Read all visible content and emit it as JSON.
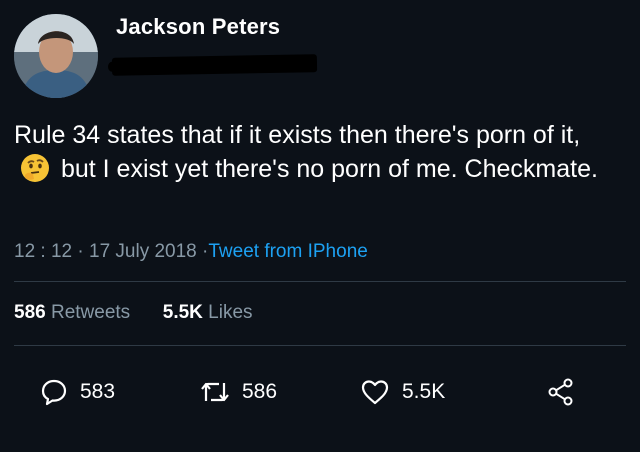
{
  "author": {
    "name": "Jackson Peters"
  },
  "tweet": {
    "text_part1": "Rule 34 states that if it exists then there's porn of it,",
    "emoji": "thinking-face-emoji",
    "text_part2": "but I exist yet there's no porn of me. Checkmate.",
    "time": "12 : 12",
    "date": "17 July 2018",
    "source": "Tweet from IPhone"
  },
  "stats": {
    "retweets_count": "586",
    "retweets_label": "Retweets",
    "likes_count": "5.5K",
    "likes_label": "Likes"
  },
  "actions": {
    "reply_count": "583",
    "retweet_count": "586",
    "like_count": "5.5K",
    "reply_icon": "comment-icon",
    "retweet_icon": "retweet-icon",
    "like_icon": "heart-icon",
    "share_icon": "share-icon"
  },
  "colors": {
    "background": "#0c1118",
    "muted": "#8899a6",
    "link": "#1da1f2"
  }
}
